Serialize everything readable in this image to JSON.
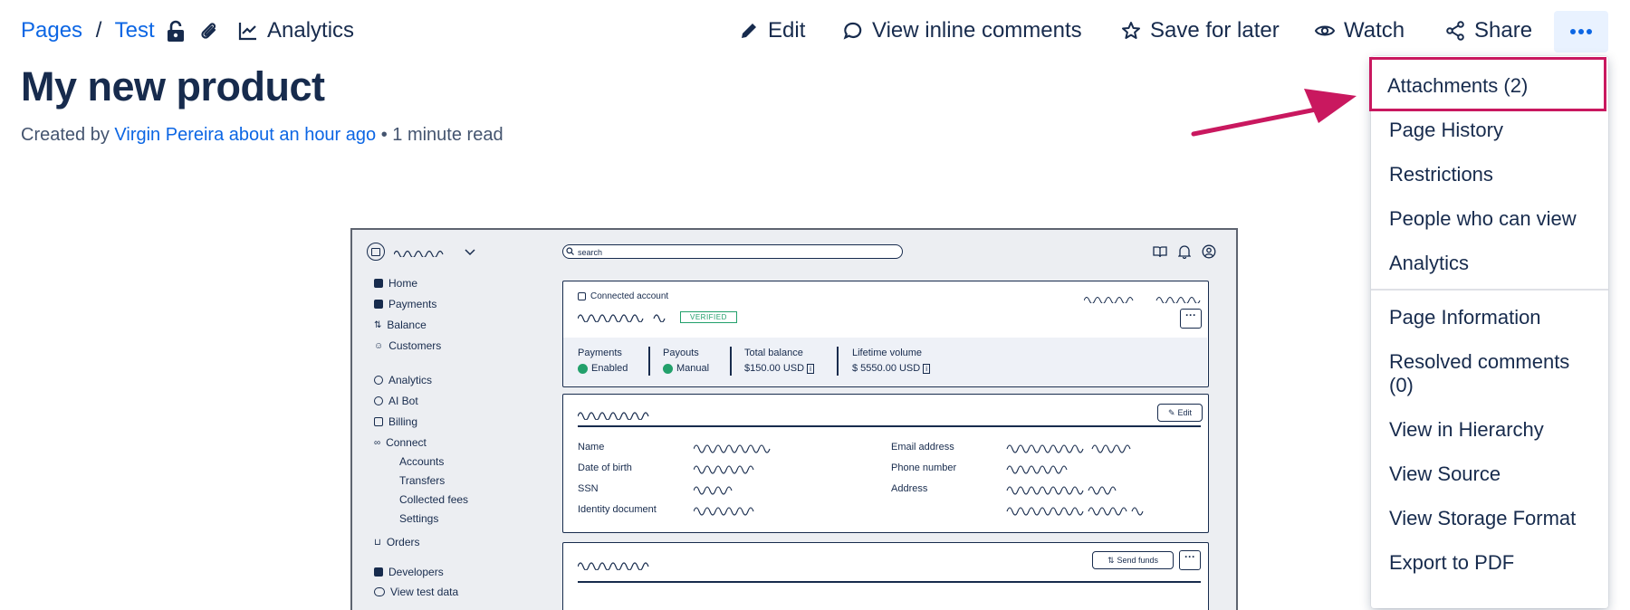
{
  "breadcrumb": {
    "items": [
      "Pages",
      "Test"
    ],
    "separator": "/"
  },
  "toolbar": {
    "analytics_label": "Analytics",
    "edit_label": "Edit",
    "view_inline_comments_label": "View inline comments",
    "save_for_later_label": "Save for later",
    "watch_label": "Watch",
    "share_label": "Share"
  },
  "page": {
    "title": "My new product",
    "byline_prefix": "Created by",
    "author": "Virgin Pereira",
    "time_ago": "about an hour ago",
    "read_time": "• 1 minute read"
  },
  "sketch": {
    "search_placeholder": "search",
    "sidebar": {
      "items": [
        "Home",
        "Payments",
        "Balance",
        "Customers",
        "Analytics",
        "AI Bot",
        "Billing",
        "Connect"
      ],
      "connect_sub": [
        "Accounts",
        "Transfers",
        "Collected fees",
        "Settings"
      ],
      "bottom": [
        "Orders",
        "Developers",
        "View test data"
      ]
    },
    "account_card": {
      "title": "Connected account",
      "badge": "VERIFIED",
      "stats": [
        {
          "label": "Payments",
          "value": "Enabled"
        },
        {
          "label": "Payouts",
          "value": "Manual"
        },
        {
          "label": "Total balance",
          "value": "$150.00 USD"
        },
        {
          "label": "Lifetime volume",
          "value": "$ 5550.00 USD"
        }
      ]
    },
    "details_card": {
      "edit_label": "Edit",
      "left_fields": [
        "Name",
        "Date of birth",
        "SSN",
        "Identity document"
      ],
      "right_fields": [
        "Email address",
        "Phone number",
        "Address"
      ]
    },
    "funds_card": {
      "send_label": "Send funds"
    }
  },
  "menu": {
    "highlighted": "Attachments (2)",
    "group1": [
      "Page History",
      "Restrictions",
      "People who can view",
      "Analytics"
    ],
    "group2": [
      "Page Information",
      "Resolved comments",
      "(0)",
      "View in Hierarchy",
      "View Source",
      "View Storage Format",
      "Export to PDF"
    ]
  },
  "colors": {
    "link": "#0c66e4",
    "text": "#172b4d",
    "highlight": "#c9185f",
    "more_button_bg": "#e9f2ff",
    "verified": "#22a06b"
  }
}
